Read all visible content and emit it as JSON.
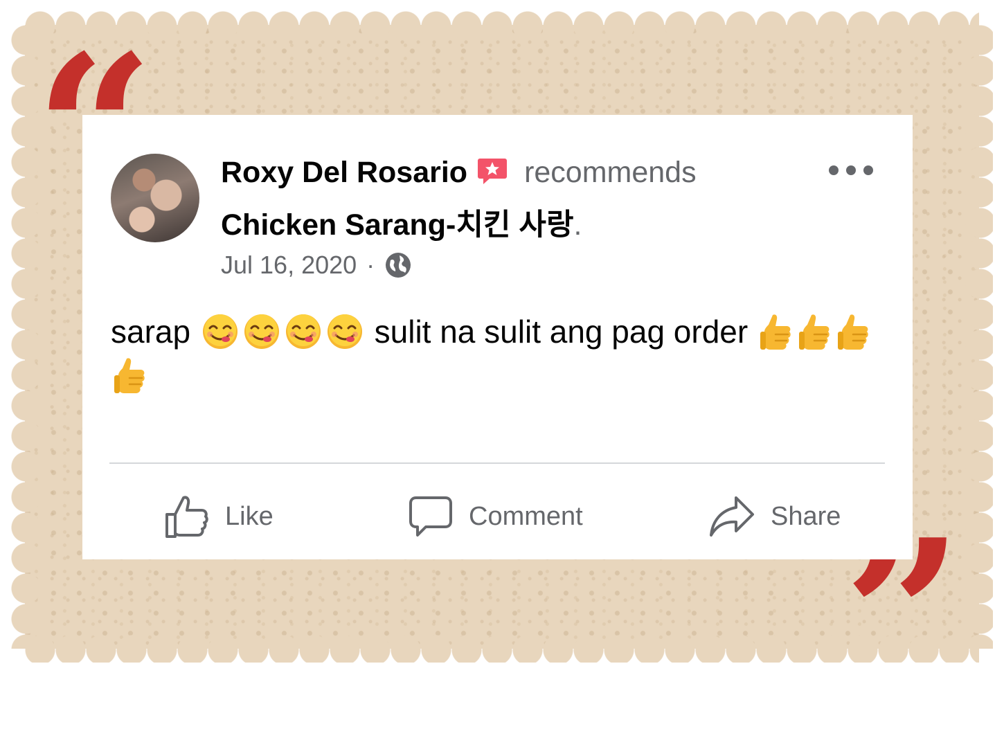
{
  "post": {
    "author": "Roxy Del Rosario",
    "action_text": "recommends",
    "page_name": "Chicken Sarang-치킨 사랑",
    "page_name_suffix": ".",
    "date": "Jul 16, 2020",
    "separator": "·",
    "privacy_icon": "globe-icon",
    "body_text_1": "sarap",
    "body_text_2": "sulit na sulit ang pag order",
    "emoji_face": "face-savoring-food-emoji",
    "emoji_thumb": "thumbs-up-emoji",
    "face_count": 4,
    "thumb_count": 4
  },
  "actions": {
    "like": "Like",
    "comment": "Comment",
    "share": "Share"
  },
  "colors": {
    "frame": "#e8d6bd",
    "quote": "#c4302b",
    "badge": "#f35369",
    "secondary_text": "#65676b"
  }
}
